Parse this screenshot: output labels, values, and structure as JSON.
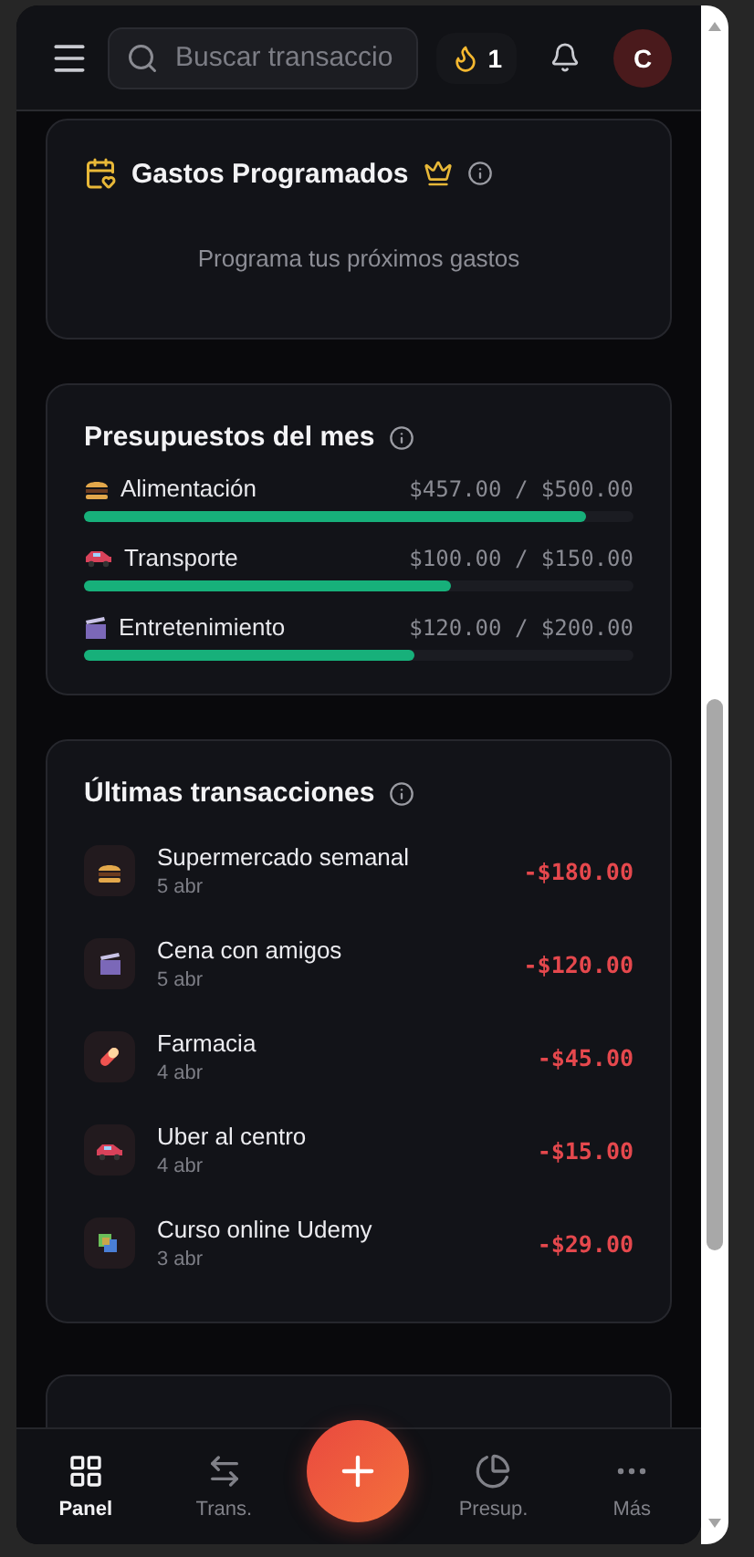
{
  "header": {
    "search": {
      "placeholder": "Buscar transaccio"
    },
    "streak": "1",
    "avatar": "C"
  },
  "scheduled": {
    "title": "Gastos Programados",
    "empty_text": "Programa tus próximos gastos"
  },
  "budgets": {
    "title": "Presupuestos del mes",
    "items": [
      {
        "kind": "food",
        "name": "Alimentación",
        "amount": "$457.00 / $500.00",
        "level": 0.914
      },
      {
        "kind": "car",
        "name": "Transporte",
        "amount": "$100.00 / $150.00",
        "level": 0.667
      },
      {
        "kind": "clapper",
        "name": "Entretenimiento",
        "amount": "$120.00 / $200.00",
        "level": 0.6
      }
    ]
  },
  "transactions": {
    "title": "Últimas transacciones",
    "items": [
      {
        "kind": "food",
        "name": "Supermercado semanal",
        "date": "5 abr",
        "amount": "-$180.00"
      },
      {
        "kind": "clapper",
        "name": "Cena con amigos",
        "date": "5 abr",
        "amount": "-$120.00"
      },
      {
        "kind": "pill",
        "name": "Farmacia",
        "date": "4 abr",
        "amount": "-$45.00"
      },
      {
        "kind": "car",
        "name": "Uber al centro",
        "date": "4 abr",
        "amount": "-$15.00"
      },
      {
        "kind": "books",
        "name": "Curso online Udemy",
        "date": "3 abr",
        "amount": "-$29.00"
      }
    ]
  },
  "nav": [
    {
      "kind": "panel",
      "label": "Panel",
      "selected": true
    },
    {
      "kind": "trans",
      "label": "Trans.",
      "selected": false
    },
    {
      "kind": "add"
    },
    {
      "kind": "budget",
      "label": "Presup.",
      "selected": false
    },
    {
      "kind": "more",
      "label": "Más",
      "selected": false
    }
  ]
}
